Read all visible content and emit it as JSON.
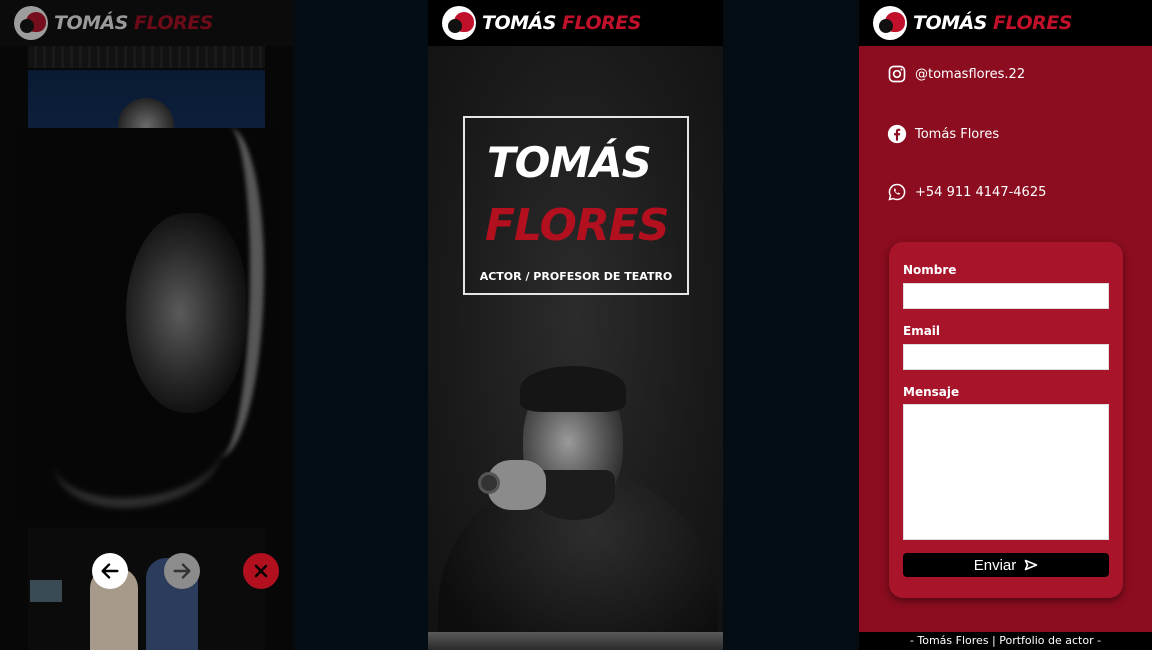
{
  "brand": {
    "first": "TOMÁS",
    "second": "FLORES"
  },
  "hero": {
    "first_name": "TOMÁS",
    "last_name": "FLORES",
    "subtitle": "ACTOR / PROFESOR DE TEATRO"
  },
  "social": {
    "instagram": "@tomasflores.22",
    "facebook": "Tomás Flores",
    "whatsapp": "+54 911 4147-4625"
  },
  "contact_form": {
    "name_label": "Nombre",
    "email_label": "Email",
    "message_label": "Mensaje",
    "submit_label": "Enviar"
  },
  "footer": {
    "text": "- Tomás Flores | Portfolio de actor -"
  },
  "colors": {
    "accent": "#b3101f",
    "panel_red": "#8c0d1f",
    "card_red": "#a8152b"
  },
  "icons": [
    "theatre-mask-icon",
    "arrow-left-icon",
    "arrow-right-icon",
    "close-icon",
    "instagram-icon",
    "facebook-icon",
    "whatsapp-icon",
    "send-icon"
  ]
}
